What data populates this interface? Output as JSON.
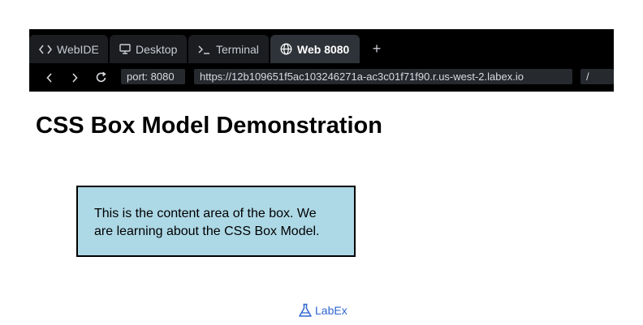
{
  "browser": {
    "tabs": [
      {
        "label": "WebIDE",
        "icon": "code-icon",
        "active": false
      },
      {
        "label": "Desktop",
        "icon": "desktop-icon",
        "active": false
      },
      {
        "label": "Terminal",
        "icon": "terminal-icon",
        "active": false
      },
      {
        "label": "Web 8080",
        "icon": "globe-icon",
        "active": true
      }
    ],
    "add_tab_label": "+",
    "port_label": "port: 8080",
    "url": "https://12b109651f5ac103246271a-ac3c01f71f90.r.us-west-2.labex.io",
    "path": "/"
  },
  "page": {
    "heading": "CSS Box Model Demonstration",
    "box_text": "This is the content area of the box. We are learning about the CSS Box Model."
  },
  "footer": {
    "brand": "LabEx"
  },
  "colors": {
    "chrome_bg": "#000000",
    "active_tab_bg": "#2e3339",
    "box_bg": "#add8e6",
    "brand": "#2f66d0"
  }
}
